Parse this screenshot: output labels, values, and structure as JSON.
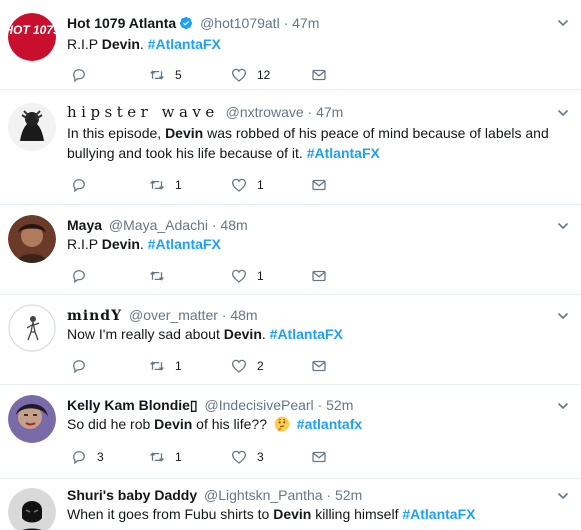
{
  "tweets": [
    {
      "name": "Hot 1079 Atlanta",
      "handle": "@hot1079atl",
      "dot": "·",
      "time": "47m",
      "text_before": "R.I.P ",
      "bold": "Devin",
      "text_after": ". ",
      "hashtag": "#AtlantaFX",
      "reply_count": "",
      "retweet_count": "5",
      "like_count": "12",
      "avatar_text": "HOT 1079"
    },
    {
      "name": "hipster wave",
      "handle": "@nxtrowave",
      "dot": "·",
      "time": "47m",
      "text_before": "In this episode, ",
      "bold": "Devin",
      "text_after": " was robbed of his peace of mind because of labels and bullying and took his life because of it. ",
      "hashtag": "#AtlantaFX",
      "reply_count": "",
      "retweet_count": "1",
      "like_count": "1"
    },
    {
      "name": "Maya",
      "handle": "@Maya_Adachi",
      "dot": "·",
      "time": "48m",
      "text_before": "R.I.P ",
      "bold": "Devin",
      "text_after": ". ",
      "hashtag": "#AtlantaFX",
      "reply_count": "",
      "retweet_count": "",
      "like_count": "1"
    },
    {
      "name": "mindY",
      "handle": "@over_matter",
      "dot": "·",
      "time": "48m",
      "text_before": "Now I'm really sad about ",
      "bold": "Devin",
      "text_after": ". ",
      "hashtag": "#AtlantaFX",
      "reply_count": "",
      "retweet_count": "1",
      "like_count": "2"
    },
    {
      "name": "Kelly Kam Blondie▯",
      "handle": "@IndecisivePearl",
      "dot": "·",
      "time": "52m",
      "text_before": "So did he rob ",
      "bold": "Devin",
      "text_after": " of his life?? ",
      "hashtag": "#atlantafx",
      "reply_count": "3",
      "retweet_count": "1",
      "like_count": "3"
    },
    {
      "name": "Shuri's baby Daddy",
      "handle": "@Lightskn_Pantha",
      "dot": "·",
      "time": "52m",
      "text_before": "When it goes from Fubu shirts to ",
      "bold": "Devin",
      "text_after": " killing himself ",
      "hashtag": "#AtlantaFX"
    }
  ],
  "icons": {
    "reply": "reply-icon",
    "retweet": "retweet-icon",
    "like": "heart-icon",
    "dm": "envelope-icon",
    "chevron": "chevron-down-icon",
    "verified": "verified-badge-icon",
    "thinking": "thinking-face-emoji"
  },
  "colors": {
    "hashtag": "#1da1f2",
    "secondary_text": "#657786",
    "divider": "#e6ecf0",
    "verified": "#1da1f2"
  }
}
